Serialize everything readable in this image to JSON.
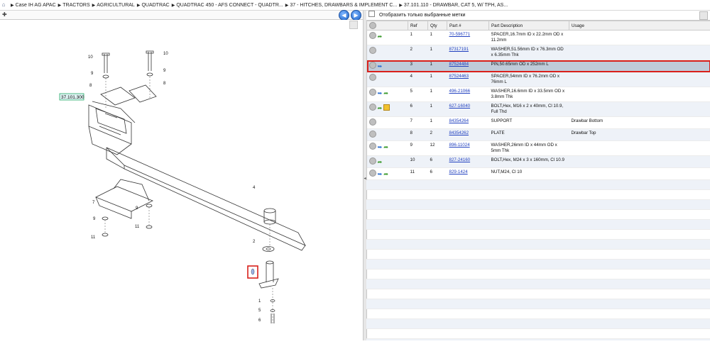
{
  "breadcrumb": [
    "Case IH AG APAC",
    "TRACTORS",
    "AGRICULTURAL",
    "QUADTRAC",
    "QUADTRAC 450 - AFS CONNECT - QUADTR...",
    "37 - HITCHES, DRAWBARS & IMPLEMENT C...",
    "37.101.110 - DRAWBAR, CAT 5, W/ TPH, AS..."
  ],
  "icons": {
    "home": "home-icon",
    "back": "back-arrow-icon",
    "forward": "forward-arrow-icon"
  },
  "filter": {
    "label": "Отобразить только выбранные метки"
  },
  "table": {
    "headers": [
      "",
      "Ref",
      "Qty",
      "Part #",
      "Part Description",
      "Usage"
    ],
    "rows": [
      {
        "ref": "1",
        "qty": "1",
        "part": "70-596771",
        "desc": "SPACER,16.7mm ID x 22.2mm OD x 11.2mm",
        "usage": "",
        "icons": [
          "circle",
          "green"
        ]
      },
      {
        "ref": "2",
        "qty": "1",
        "part": "87317191",
        "desc": "WASHER,51.56mm ID x 76.3mm OD x 6.35mm Thk",
        "usage": "",
        "icons": [
          "circle"
        ]
      },
      {
        "ref": "3",
        "qty": "1",
        "part": "87524484",
        "desc": "PIN,50.65mm OD x 252mm L",
        "usage": "",
        "icons": [
          "circle",
          "blue"
        ],
        "selected": true
      },
      {
        "ref": "4",
        "qty": "1",
        "part": "87524463",
        "desc": "SPACER,54mm ID x 76.2mm OD x 76mm L",
        "usage": "",
        "icons": [
          "circle"
        ]
      },
      {
        "ref": "5",
        "qty": "1",
        "part": "496-21066",
        "desc": "WASHER,16.6mm ID x 33.5mm OD x 3.8mm Thk",
        "usage": "",
        "icons": [
          "circle",
          "blue",
          "green"
        ]
      },
      {
        "ref": "6",
        "qty": "1",
        "part": "627-16040",
        "desc": "BOLT,Hex, M16 x 2 x 40mm, Cl 10.9, Full Thd",
        "usage": "",
        "icons": [
          "circle",
          "green",
          "yellow"
        ]
      },
      {
        "ref": "7",
        "qty": "1",
        "part": "84354264",
        "desc": "SUPPORT",
        "usage": "Drawbar Bottom",
        "icons": [
          "circle"
        ]
      },
      {
        "ref": "8",
        "qty": "2",
        "part": "84354262",
        "desc": "PLATE",
        "usage": "Drawbar Top",
        "icons": [
          "circle"
        ]
      },
      {
        "ref": "9",
        "qty": "12",
        "part": "896-11024",
        "desc": "WASHER,26mm ID x 44mm OD x 5mm Thk",
        "usage": "",
        "icons": [
          "circle",
          "blue",
          "green"
        ]
      },
      {
        "ref": "10",
        "qty": "6",
        "part": "827-24160",
        "desc": "BOLT,Hex, M24 x 3 x 160mm, Cl 10.9",
        "usage": "",
        "icons": [
          "circle",
          "green"
        ]
      },
      {
        "ref": "11",
        "qty": "6",
        "part": "829-1424",
        "desc": "NUT,M24, Cl 10",
        "usage": "",
        "icons": [
          "circle",
          "blue",
          "green"
        ]
      }
    ]
  },
  "diagram": {
    "callout_label": "37.101.300",
    "refs": [
      "10",
      "9",
      "8",
      "10",
      "9",
      "8",
      "4",
      "7",
      "9",
      "11",
      "11",
      "9",
      "2",
      "1",
      "5",
      "6"
    ]
  },
  "colors": {
    "selected_outline": "#d9201b",
    "link": "#1f3fbf",
    "selected_row": "#bfcbd9"
  }
}
